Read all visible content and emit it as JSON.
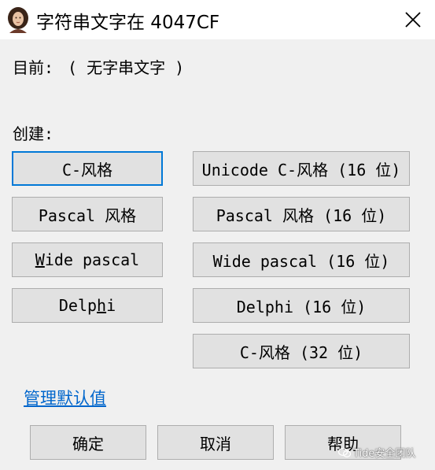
{
  "window": {
    "title": "字符串文字在 4047CF",
    "app_icon": "portrait-icon",
    "close_icon": "close-icon"
  },
  "current": {
    "label": "目前:",
    "value": "( 无字串文字 )"
  },
  "create": {
    "label": "创建:",
    "left_buttons": [
      {
        "pre": "C-风格",
        "u": "",
        "post": ""
      },
      {
        "pre": "Pascal 风格",
        "u": "",
        "post": ""
      },
      {
        "pre": "",
        "u": "W",
        "post": "ide pascal"
      },
      {
        "pre": "Delp",
        "u": "h",
        "post": "i"
      }
    ],
    "right_buttons": [
      "Unicode C-风格 (16 位)",
      "Pascal 风格 (16 位)",
      "Wide pascal (16 位)",
      "Delphi (16 位)",
      "C-风格 (32 位)"
    ]
  },
  "manage_link": "管理默认值",
  "footer": {
    "ok": "确定",
    "cancel": "取消",
    "help": "帮助"
  },
  "watermark": "Tide安全团队",
  "colors": {
    "accent": "#0078d7",
    "link": "#0066cc",
    "button_bg": "#e1e1e1",
    "dialog_bg": "#f0f0f0"
  }
}
